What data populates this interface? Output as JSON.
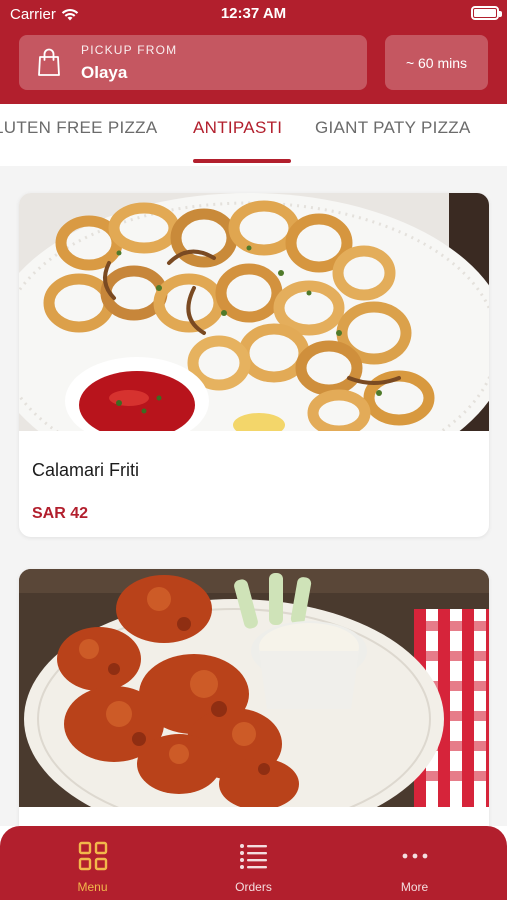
{
  "status_bar": {
    "carrier": "Carrier",
    "time": "12:37 AM",
    "icons": [
      "wifi-icon",
      "battery-icon"
    ]
  },
  "header": {
    "pickup_label": "PICKUP FROM",
    "pickup_location": "Olaya",
    "eta": "~ 60 mins",
    "icon": "shopping-bag-icon"
  },
  "tabs": {
    "items": [
      {
        "label": "LUTEN FREE PIZZA"
      },
      {
        "label": "ANTIPASTI"
      },
      {
        "label": "GIANT PATY PIZZA"
      }
    ],
    "active_index": 1
  },
  "menu_items": [
    {
      "name": "Calamari Friti",
      "price": "SAR 42",
      "image": "fried calamari rings with red dipping sauce"
    },
    {
      "name": "",
      "price": "",
      "image": "fried chicken wings with celery and ranch dip"
    }
  ],
  "bottom_nav": {
    "items": [
      {
        "label": "Menu",
        "icon": "grid-icon",
        "active": true
      },
      {
        "label": "Orders",
        "icon": "list-icon",
        "active": false
      },
      {
        "label": "More",
        "icon": "more-dots-icon",
        "active": false
      }
    ]
  },
  "colors": {
    "brand": "#b21f2d",
    "accent": "#f2b84b",
    "price": "#b21f2d"
  }
}
